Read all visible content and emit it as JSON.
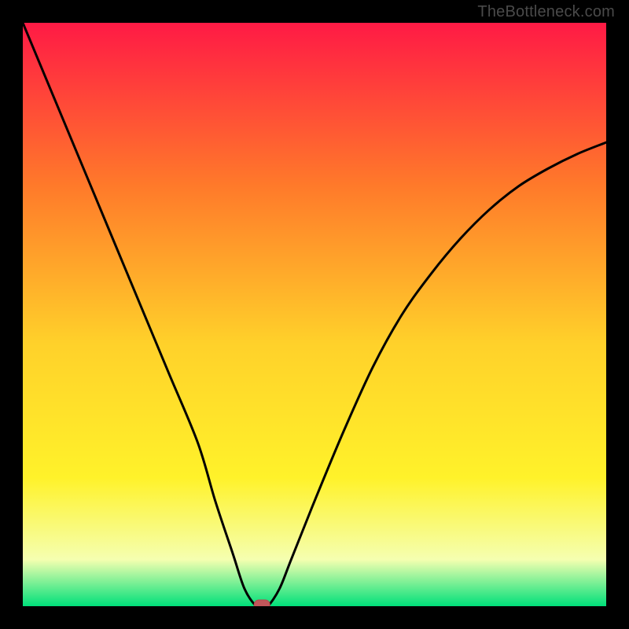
{
  "watermark": "TheBottleneck.com",
  "colors": {
    "background": "#000000",
    "gradient_top": "#ff1a45",
    "gradient_mid1": "#ff7a2a",
    "gradient_mid2": "#ffd12a",
    "gradient_mid3": "#fff22a",
    "gradient_pale": "#f5ffb0",
    "gradient_bottom": "#00e07a",
    "curve": "#000000",
    "marker_fill": "#c1565a",
    "marker_stroke": "#b24a4e"
  },
  "chart_data": {
    "type": "line",
    "title": "",
    "xlabel": "",
    "ylabel": "",
    "xlim": [
      0,
      100
    ],
    "ylim": [
      0,
      100
    ],
    "series": [
      {
        "name": "bottleneck-curve",
        "x": [
          0,
          5,
          10,
          15,
          20,
          25,
          30,
          33,
          36,
          38,
          40,
          41,
          42,
          44,
          46,
          50,
          55,
          60,
          65,
          70,
          75,
          80,
          85,
          90,
          95,
          100
        ],
        "values": [
          100,
          88,
          76,
          64,
          52,
          40,
          28,
          18,
          9,
          3,
          0,
          0,
          0,
          3,
          8,
          18,
          30,
          41,
          50,
          57,
          63,
          68,
          72,
          75,
          77.5,
          79.5
        ]
      }
    ],
    "marker": {
      "x": 41,
      "y": 0
    },
    "grid": false,
    "legend": false
  }
}
